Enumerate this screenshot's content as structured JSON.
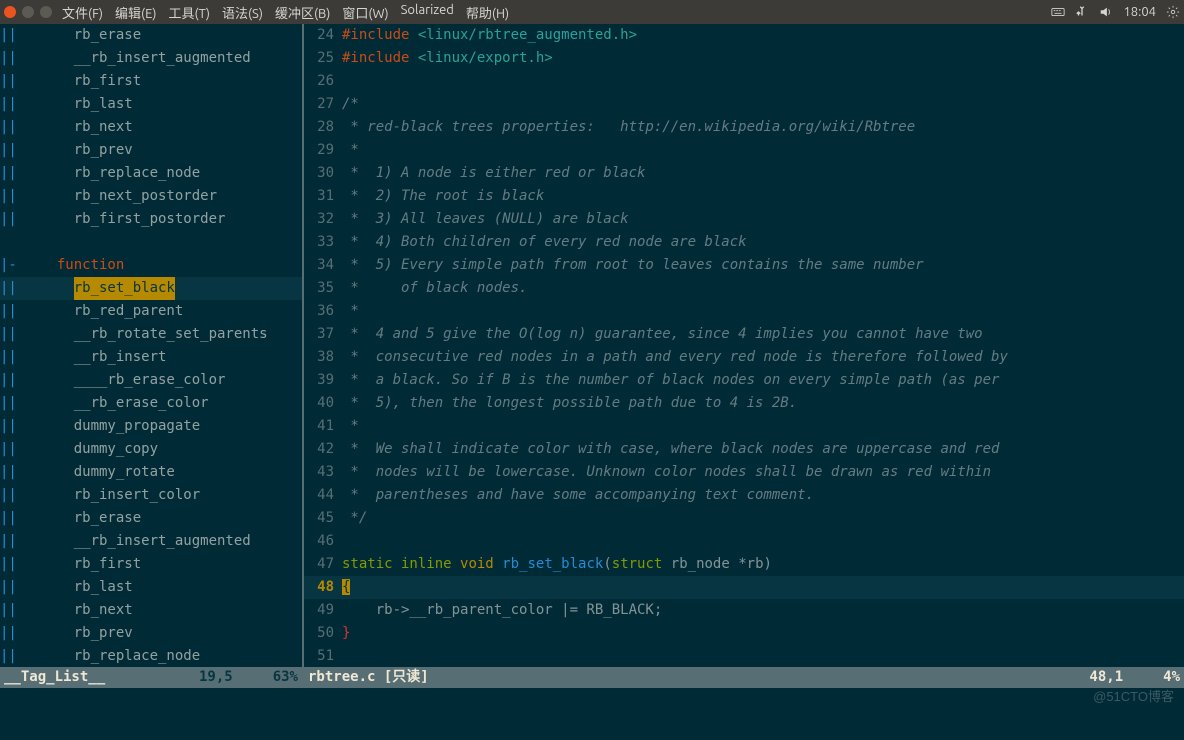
{
  "topbar": {
    "menu": [
      "文件(F)",
      "编辑(E)",
      "工具(T)",
      "语法(S)",
      "缓冲区(B)",
      "窗口(W)",
      "Solarized",
      "帮助(H)"
    ],
    "time": "18:04"
  },
  "taglist": {
    "status": {
      "name": "__Tag_List__",
      "pos": "19,5",
      "pct": "63%"
    },
    "items": [
      {
        "fold": "||",
        "indent": "    ",
        "text": "rb_erase"
      },
      {
        "fold": "||",
        "indent": "    ",
        "text": "__rb_insert_augmented"
      },
      {
        "fold": "||",
        "indent": "    ",
        "text": "rb_first"
      },
      {
        "fold": "||",
        "indent": "    ",
        "text": "rb_last"
      },
      {
        "fold": "||",
        "indent": "    ",
        "text": "rb_next"
      },
      {
        "fold": "||",
        "indent": "    ",
        "text": "rb_prev"
      },
      {
        "fold": "||",
        "indent": "    ",
        "text": "rb_replace_node"
      },
      {
        "fold": "||",
        "indent": "    ",
        "text": "rb_next_postorder"
      },
      {
        "fold": "||",
        "indent": "    ",
        "text": "rb_first_postorder"
      },
      {
        "fold": "",
        "indent": "",
        "text": ""
      },
      {
        "fold": "|-",
        "indent": "  ",
        "text": "function",
        "fn": true
      },
      {
        "fold": "||",
        "indent": "    ",
        "text": "rb_set_black",
        "hl": true,
        "cursor": true
      },
      {
        "fold": "||",
        "indent": "    ",
        "text": "rb_red_parent"
      },
      {
        "fold": "||",
        "indent": "    ",
        "text": "__rb_rotate_set_parents"
      },
      {
        "fold": "||",
        "indent": "    ",
        "text": "__rb_insert"
      },
      {
        "fold": "||",
        "indent": "    ",
        "text": "____rb_erase_color"
      },
      {
        "fold": "||",
        "indent": "    ",
        "text": "__rb_erase_color"
      },
      {
        "fold": "||",
        "indent": "    ",
        "text": "dummy_propagate"
      },
      {
        "fold": "||",
        "indent": "    ",
        "text": "dummy_copy"
      },
      {
        "fold": "||",
        "indent": "    ",
        "text": "dummy_rotate"
      },
      {
        "fold": "||",
        "indent": "    ",
        "text": "rb_insert_color"
      },
      {
        "fold": "||",
        "indent": "    ",
        "text": "rb_erase"
      },
      {
        "fold": "||",
        "indent": "    ",
        "text": "__rb_insert_augmented"
      },
      {
        "fold": "||",
        "indent": "    ",
        "text": "rb_first"
      },
      {
        "fold": "||",
        "indent": "    ",
        "text": "rb_last"
      },
      {
        "fold": "||",
        "indent": "    ",
        "text": "rb_next"
      },
      {
        "fold": "||",
        "indent": "    ",
        "text": "rb_prev"
      },
      {
        "fold": "||",
        "indent": "    ",
        "text": "rb_replace_node"
      }
    ]
  },
  "editor": {
    "status": {
      "name": "rbtree.c [只读]",
      "pos": "48,1",
      "pct": "4%"
    },
    "lines": [
      {
        "n": 24,
        "tokens": [
          [
            "#include ",
            "c-include"
          ],
          [
            "<linux/rbtree_augmented.h>",
            "c-string"
          ]
        ]
      },
      {
        "n": 25,
        "tokens": [
          [
            "#include ",
            "c-include"
          ],
          [
            "<linux/export.h>",
            "c-string"
          ]
        ]
      },
      {
        "n": 26,
        "tokens": []
      },
      {
        "n": 27,
        "tokens": [
          [
            "/*",
            "c-comment"
          ]
        ]
      },
      {
        "n": 28,
        "tokens": [
          [
            " * red-black trees properties:   http://en.wikipedia.org/wiki/Rbtree",
            "c-comment"
          ]
        ]
      },
      {
        "n": 29,
        "tokens": [
          [
            " *",
            "c-comment"
          ]
        ]
      },
      {
        "n": 30,
        "tokens": [
          [
            " *  1) A node is either red or black",
            "c-comment"
          ]
        ]
      },
      {
        "n": 31,
        "tokens": [
          [
            " *  2) The root is black",
            "c-comment"
          ]
        ]
      },
      {
        "n": 32,
        "tokens": [
          [
            " *  3) All leaves (NULL) are black",
            "c-comment"
          ]
        ]
      },
      {
        "n": 33,
        "tokens": [
          [
            " *  4) Both children of every red node are black",
            "c-comment"
          ]
        ]
      },
      {
        "n": 34,
        "tokens": [
          [
            " *  5) Every simple path from root to leaves contains the same number",
            "c-comment"
          ]
        ]
      },
      {
        "n": 35,
        "tokens": [
          [
            " *     of black nodes.",
            "c-comment"
          ]
        ]
      },
      {
        "n": 36,
        "tokens": [
          [
            " *",
            "c-comment"
          ]
        ]
      },
      {
        "n": 37,
        "tokens": [
          [
            " *  4 and 5 give the O(log n) guarantee, since 4 implies you cannot have two",
            "c-comment"
          ]
        ]
      },
      {
        "n": 38,
        "tokens": [
          [
            " *  consecutive red nodes in a path and every red node is therefore followed by",
            "c-comment"
          ]
        ]
      },
      {
        "n": 39,
        "tokens": [
          [
            " *  a black. So if B is the number of black nodes on every simple path (as per",
            "c-comment"
          ]
        ]
      },
      {
        "n": 40,
        "tokens": [
          [
            " *  5), then the longest possible path due to 4 is 2B.",
            "c-comment"
          ]
        ]
      },
      {
        "n": 41,
        "tokens": [
          [
            " *",
            "c-comment"
          ]
        ]
      },
      {
        "n": 42,
        "tokens": [
          [
            " *  We shall indicate color with case, where black nodes are uppercase and red",
            "c-comment"
          ]
        ]
      },
      {
        "n": 43,
        "tokens": [
          [
            " *  nodes will be lowercase. Unknown color nodes shall be drawn as red within",
            "c-comment"
          ]
        ]
      },
      {
        "n": 44,
        "tokens": [
          [
            " *  parentheses and have some accompanying text comment.",
            "c-comment"
          ]
        ]
      },
      {
        "n": 45,
        "tokens": [
          [
            " */",
            "c-comment"
          ]
        ]
      },
      {
        "n": 46,
        "tokens": []
      },
      {
        "n": 47,
        "tokens": [
          [
            "static inline ",
            "c-keyword"
          ],
          [
            "void ",
            "c-type"
          ],
          [
            "rb_set_black",
            "c-func"
          ],
          [
            "(",
            ""
          ],
          [
            "struct ",
            "c-keyword"
          ],
          [
            "rb_node *rb)",
            ""
          ]
        ]
      },
      {
        "n": 48,
        "cursor": true,
        "tokens": [
          [
            "{",
            "c-bracket-hl"
          ]
        ]
      },
      {
        "n": 49,
        "tokens": [
          [
            "    rb->__rb_parent_color |= RB_BLACK;",
            ""
          ]
        ]
      },
      {
        "n": 50,
        "tokens": [
          [
            "}",
            "c-punct"
          ]
        ]
      },
      {
        "n": 51,
        "tokens": []
      }
    ]
  },
  "watermark": "@51CTO博客"
}
